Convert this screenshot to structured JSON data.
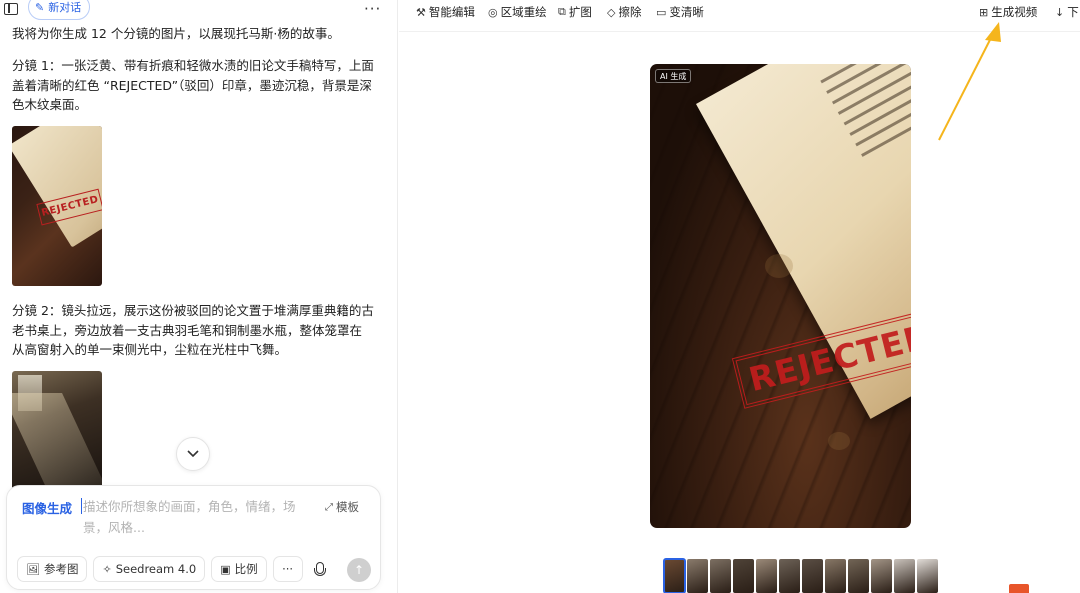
{
  "left": {
    "new_chat_label": "新对话",
    "more": "···",
    "messages": {
      "intro": "我将为你生成 12 个分镜的图片，以展现托马斯·杨的故事。",
      "shot1": "分镜 1：一张泛黄、带有折痕和轻微水渍的旧论文手稿特写，上面盖着清晰的红色 “REJECTED”（驳回）印章，墨迹沉稳，背景是深色木纹桌面。",
      "shot1_stamp": "REJECTED",
      "shot2": "分镜 2：镜头拉远，展示这份被驳回的论文置于堆满厚重典籍的古老书桌上，旁边放着一支古典羽毛笔和铜制墨水瓶，整体笼罩在从高窗射入的单一束侧光中，尘粒在光柱中飞舞。"
    },
    "composer": {
      "mode": "图像生成",
      "placeholder": "描述你所想象的画面，角色，情绪，场景，风格...",
      "template": "模板",
      "reference": "参考图",
      "model": "Seedream 4.0",
      "ratio": "比例",
      "more": "···"
    }
  },
  "toolbar": {
    "smart_edit": "智能编辑",
    "area_redraw": "区域重绘",
    "expand": "扩图",
    "erase": "擦除",
    "hd": "变清晰",
    "gen_video": "生成视频",
    "download": "下"
  },
  "preview": {
    "ai_badge": "AI 生成",
    "stamp_text": "REJECTED",
    "thumb_colors": [
      "#6b4a33",
      "#8a7b6c",
      "#7c6f62",
      "#4f4338",
      "#9b8a79",
      "#6d6257",
      "#5a4e44",
      "#877766",
      "#726556",
      "#a39587",
      "#c9c2bb",
      "#e2ddd8"
    ]
  },
  "colors": {
    "accent": "#2a62e3",
    "stamp_red": "#c21d1d",
    "arrow": "#f5b51c"
  }
}
